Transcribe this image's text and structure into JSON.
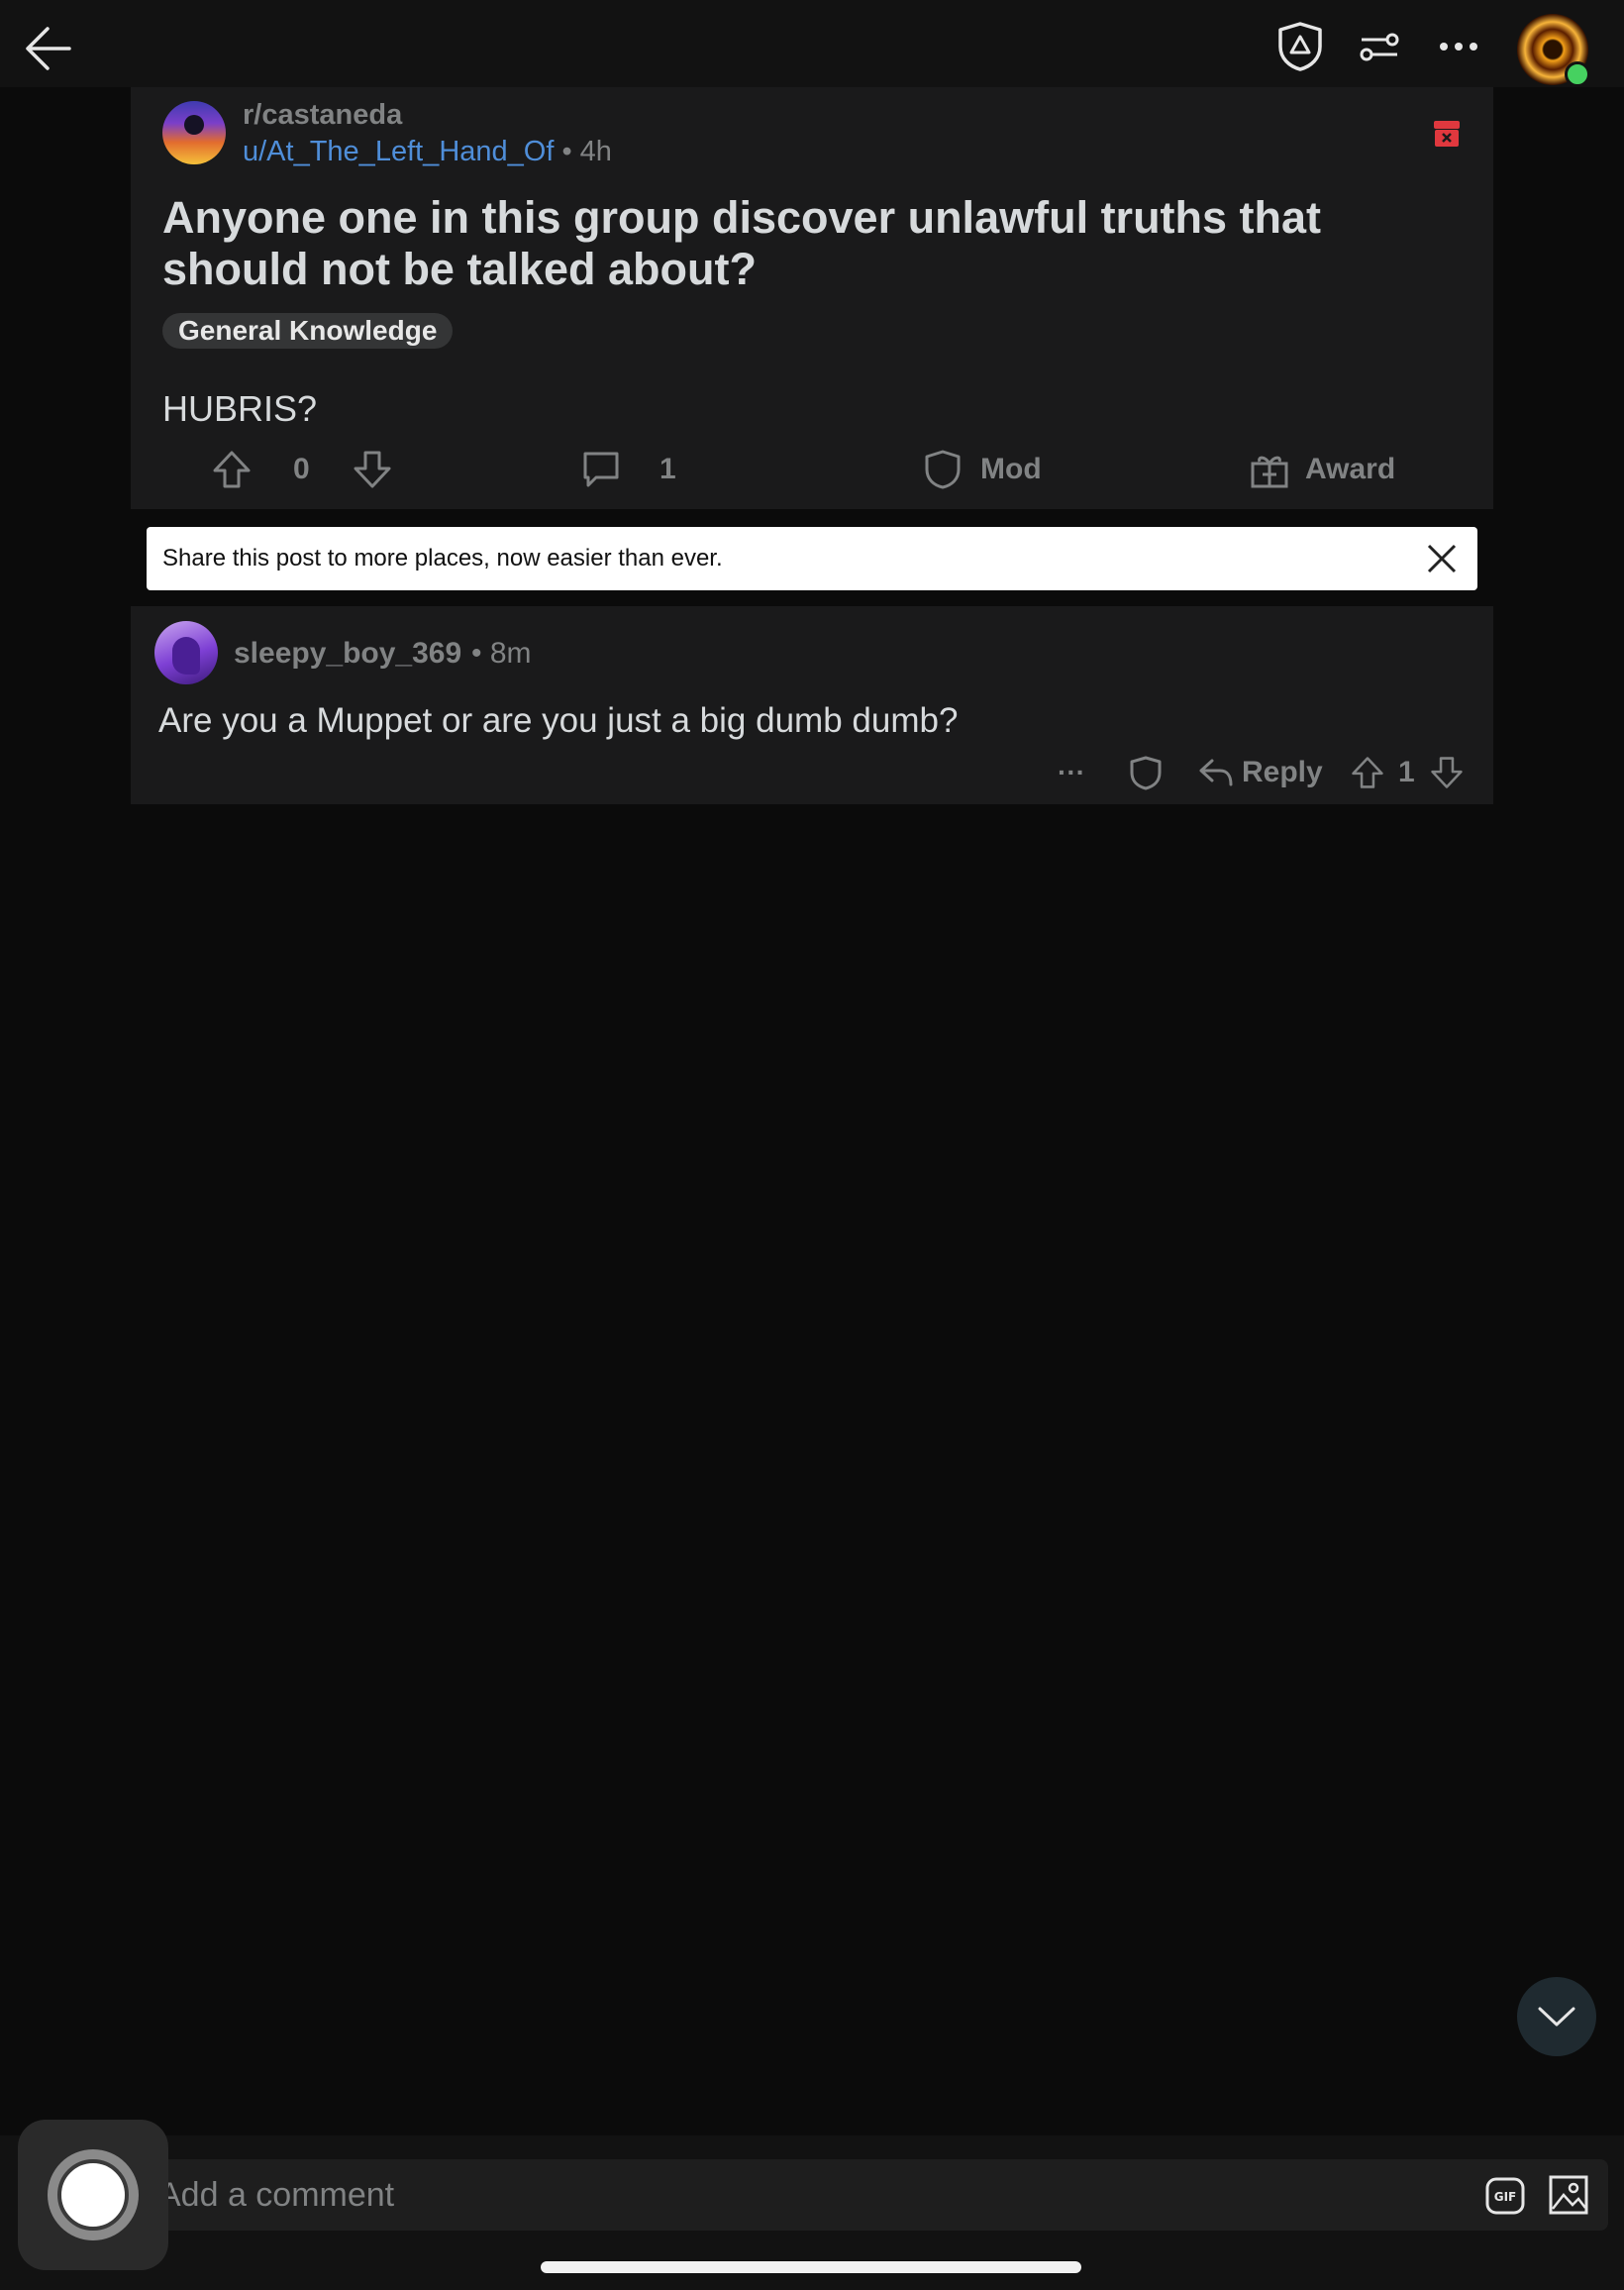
{
  "icons": {
    "back": "back-arrow-icon",
    "mod_shield": "shield-icon",
    "filter": "filter-icon",
    "more": "more-horizontal-icon",
    "removed": "removed-post-icon"
  },
  "post": {
    "subreddit": "r/castaneda",
    "author": "u/At_The_Left_Hand_Of",
    "age": "• 4h",
    "title": "Anyone one in this group discover unlawful truths that should not be talked about?",
    "flair": "General Knowledge",
    "body": "HUBRIS?",
    "score": "0",
    "comment_count": "1",
    "mod_label": "Mod",
    "award_label": "Award"
  },
  "share_banner": {
    "text": "Share this post to more places, now easier than ever."
  },
  "comment": {
    "username": "sleepy_boy_369",
    "age": "• 8m",
    "text": "Are you a Muppet or are you just a big dumb dumb?",
    "more": "···",
    "reply_label": "Reply",
    "score": "1"
  },
  "composer": {
    "placeholder": "Add a comment"
  },
  "colors": {
    "background": "#0b0b0b",
    "card": "#1a1a1b",
    "muted_text": "#818384",
    "author_link": "#4f8ed9",
    "removed_red": "#e0383e",
    "online_green": "#46d160"
  }
}
